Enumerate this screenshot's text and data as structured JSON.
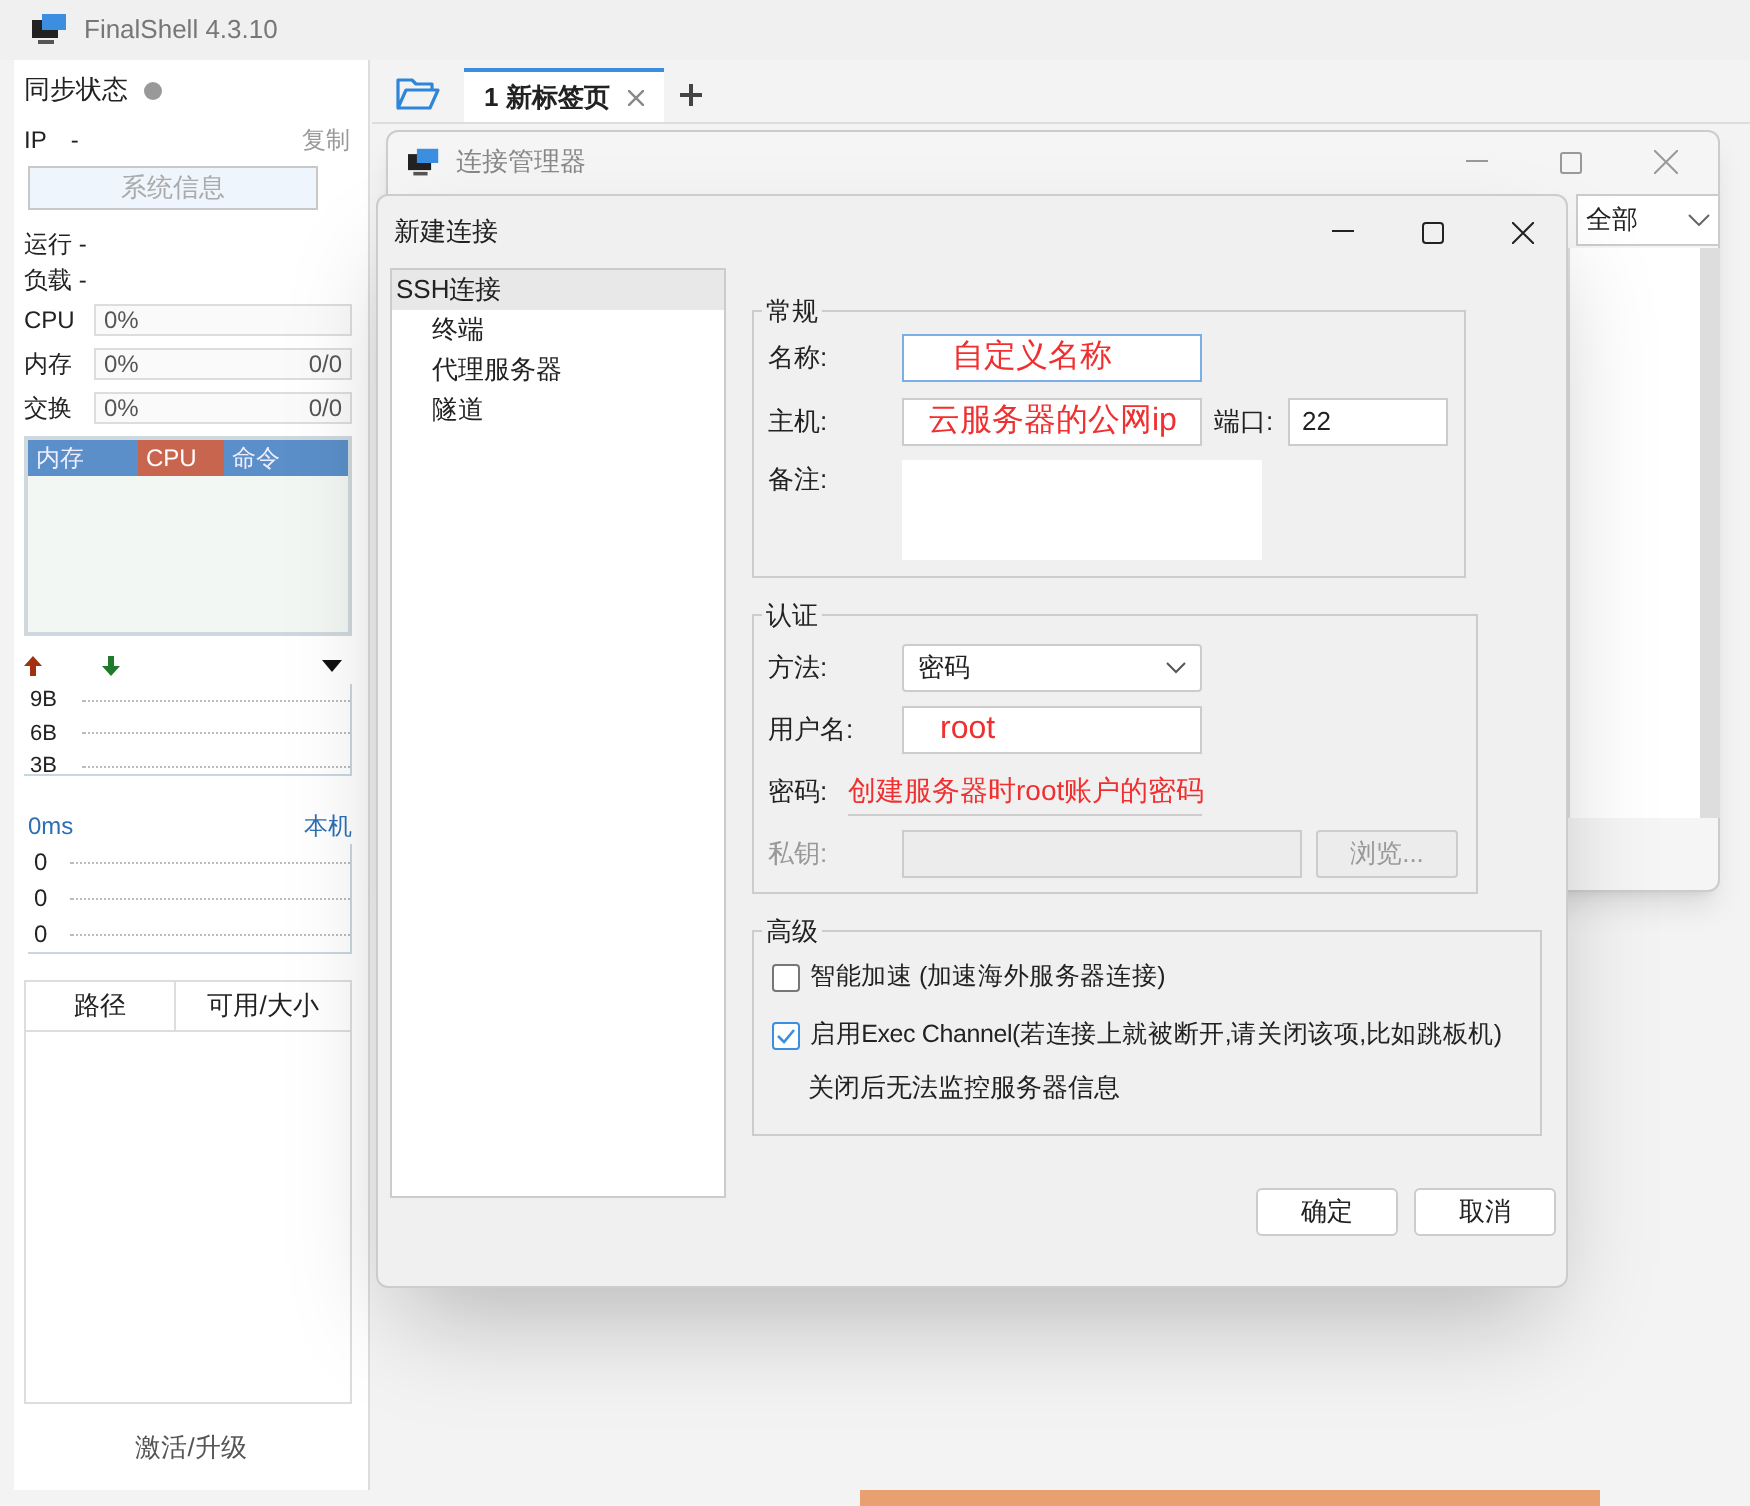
{
  "app": {
    "title": "FinalShell 4.3.10"
  },
  "sidebar": {
    "sync_label": "同步状态",
    "ip_label": "IP",
    "ip_value": "-",
    "copy_link": "复制",
    "sysinfo_button": "系统信息",
    "uptime": "运行 -",
    "load": "负载 -",
    "meters": [
      {
        "label": "CPU",
        "value": "0%"
      },
      {
        "label": "内存",
        "value": "0%",
        "total": "0/0"
      },
      {
        "label": "交换",
        "value": "0%",
        "total": "0/0"
      }
    ],
    "process_tabs": [
      {
        "label": "内存",
        "selected": false
      },
      {
        "label": "CPU",
        "selected": true
      },
      {
        "label": "命令",
        "selected": false
      }
    ],
    "net_scale": [
      "9B",
      "6B",
      "3B"
    ],
    "ping": "0ms",
    "ping_host": "本机",
    "ping_scale": [
      "0",
      "0",
      "0"
    ],
    "disk_columns": [
      "路径",
      "可用/大小"
    ],
    "activate_link": "激活/升级"
  },
  "tabs": [
    {
      "label": "1 新标签页",
      "selected": true
    }
  ],
  "connection_manager": {
    "title": "连接管理器",
    "filter": "全部"
  },
  "dialog": {
    "title": "新建连接",
    "nav": [
      {
        "label": "SSH连接",
        "selected": true,
        "children": [
          {
            "label": "终端",
            "selected": false
          },
          {
            "label": "代理服务器",
            "selected": false
          },
          {
            "label": "隧道",
            "selected": false
          }
        ]
      }
    ],
    "general": {
      "legend": "常规",
      "name_label": "名称:",
      "name_value": "自定义名称",
      "host_label": "主机:",
      "host_value": "云服务器的公网ip",
      "port_label": "端口:",
      "port_value": "22",
      "note_label": "备注:"
    },
    "auth": {
      "legend": "认证",
      "method_label": "方法:",
      "method_value": "密码",
      "user_label": "用户名:",
      "user_value": "root",
      "password_label": "密码:",
      "password_value": "创建服务器时root账户的密码",
      "key_label": "私钥:",
      "key_disabled": true,
      "browse_button": "浏览..."
    },
    "advanced": {
      "legend": "高级",
      "options": [
        {
          "label": "智能加速 (加速海外服务器连接)",
          "checked": false
        },
        {
          "label": "启用Exec Channel(若连接上就被断开,请关闭该项,比如跳板机)",
          "checked": true
        }
      ],
      "note": "关闭后无法监控服务器信息"
    },
    "buttons": [
      "确定",
      "取消"
    ]
  }
}
